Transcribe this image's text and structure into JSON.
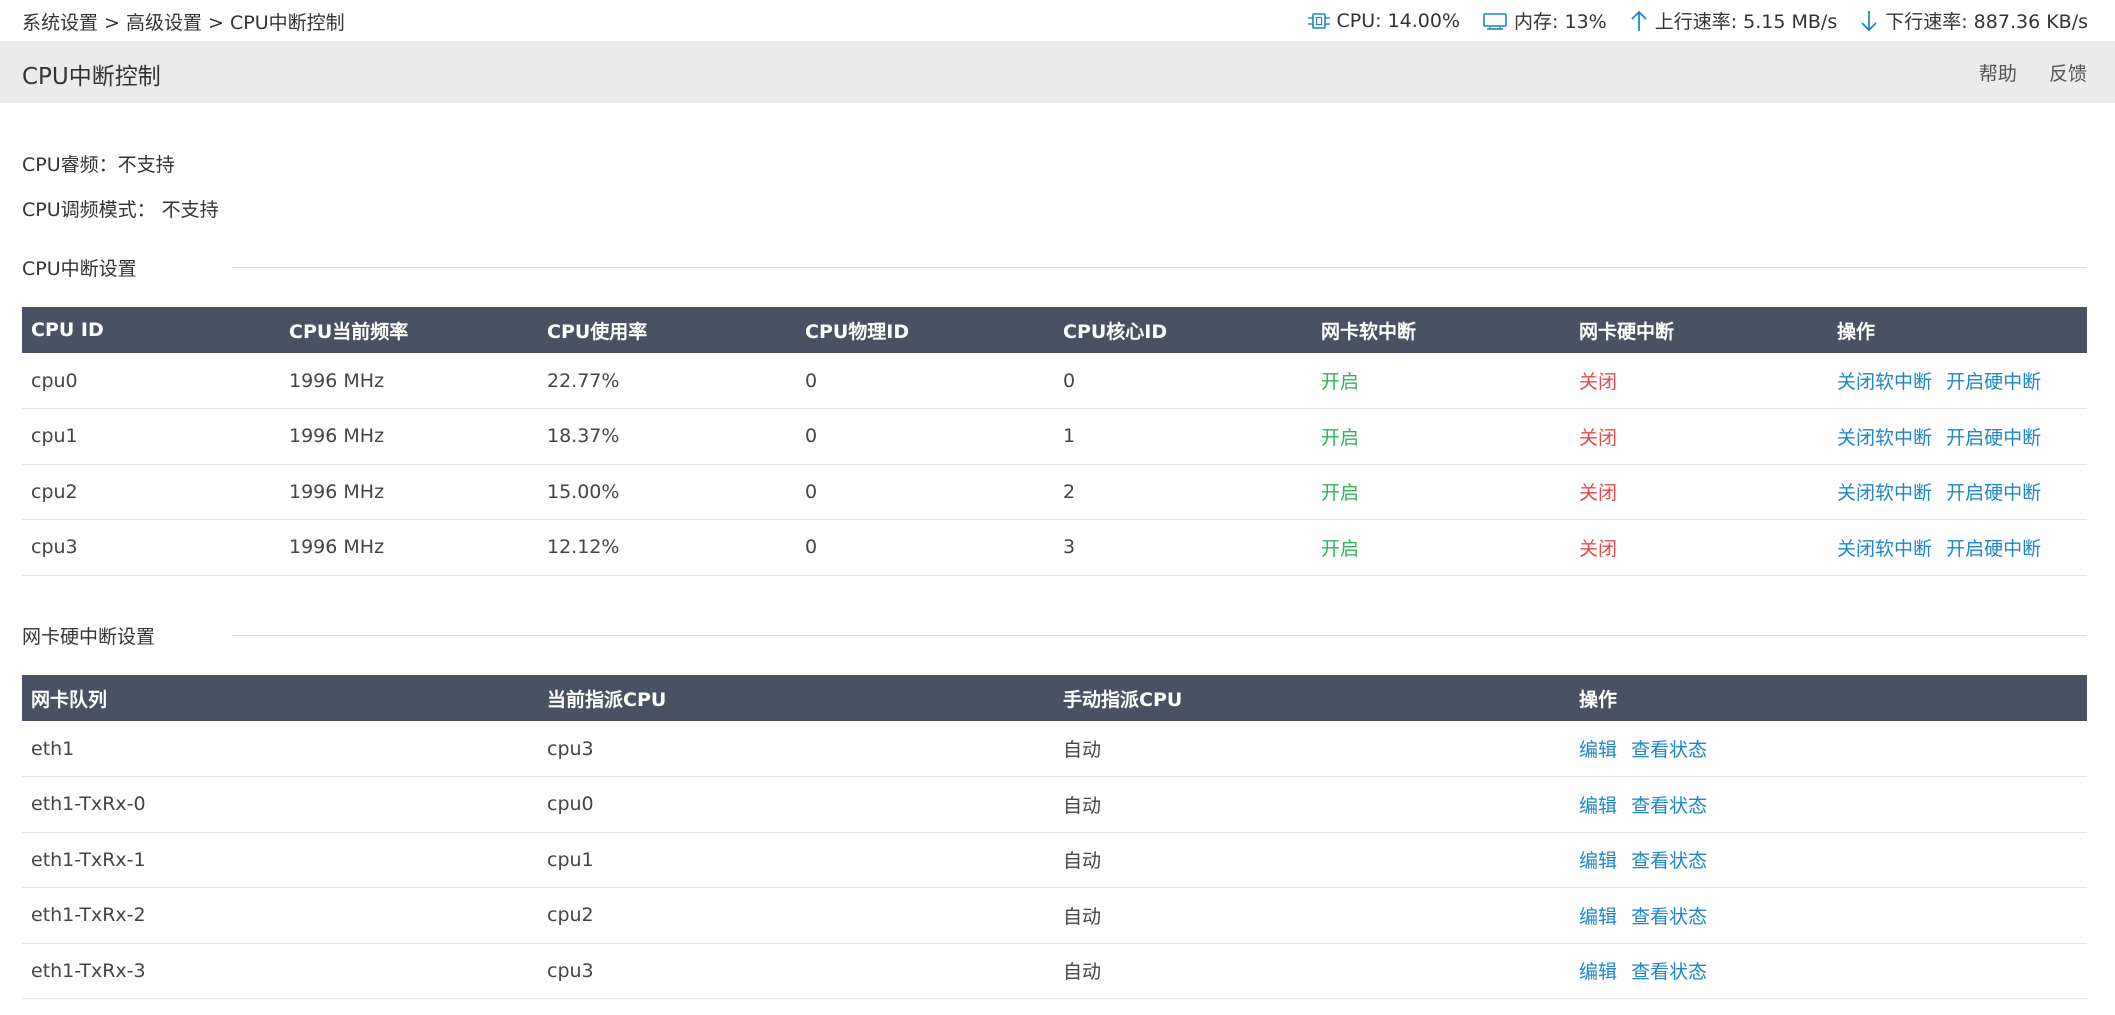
{
  "breadcrumb": "系统设置 > 高级设置 > CPU中断控制",
  "stats": {
    "cpu": "CPU: 14.00%",
    "memory": "内存: 13%",
    "upload": "上行速率: 5.15 MB/s",
    "download": "下行速率: 887.36 KB/s"
  },
  "icons": {
    "cpu": "cpu-chip-icon",
    "memory": "memory-icon",
    "upload": "arrow-up-icon",
    "download": "arrow-down-icon"
  },
  "title_bar": {
    "title": "CPU中断控制",
    "help": "帮助",
    "feedback": "反馈"
  },
  "info": {
    "turbo": "CPU睿频：不支持",
    "governor": "CPU调频模式： 不支持"
  },
  "cpu_section": {
    "title": "CPU中断设置",
    "columns": [
      "CPU ID",
      "CPU当前频率",
      "CPU使用率",
      "CPU物理ID",
      "CPU核心ID",
      "网卡软中断",
      "网卡硬中断",
      "操作"
    ],
    "rows": [
      {
        "id": "cpu0",
        "freq": "1996 MHz",
        "usage": "22.77%",
        "phys": "0",
        "core": "0",
        "soft": "开启",
        "hard": "关闭",
        "action1": "关闭软中断",
        "action2": "开启硬中断"
      },
      {
        "id": "cpu1",
        "freq": "1996 MHz",
        "usage": "18.37%",
        "phys": "0",
        "core": "1",
        "soft": "开启",
        "hard": "关闭",
        "action1": "关闭软中断",
        "action2": "开启硬中断"
      },
      {
        "id": "cpu2",
        "freq": "1996 MHz",
        "usage": "15.00%",
        "phys": "0",
        "core": "2",
        "soft": "开启",
        "hard": "关闭",
        "action1": "关闭软中断",
        "action2": "开启硬中断"
      },
      {
        "id": "cpu3",
        "freq": "1996 MHz",
        "usage": "12.12%",
        "phys": "0",
        "core": "3",
        "soft": "开启",
        "hard": "关闭",
        "action1": "关闭软中断",
        "action2": "开启硬中断"
      }
    ]
  },
  "nic_section": {
    "title": "网卡硬中断设置",
    "columns": [
      "网卡队列",
      "当前指派CPU",
      "手动指派CPU",
      "操作"
    ],
    "rows": [
      {
        "queue": "eth1",
        "current": "cpu3",
        "manual": "自动",
        "edit": "编辑",
        "view": "查看状态"
      },
      {
        "queue": "eth1-TxRx-0",
        "current": "cpu0",
        "manual": "自动",
        "edit": "编辑",
        "view": "查看状态"
      },
      {
        "queue": "eth1-TxRx-1",
        "current": "cpu1",
        "manual": "自动",
        "edit": "编辑",
        "view": "查看状态"
      },
      {
        "queue": "eth1-TxRx-2",
        "current": "cpu2",
        "manual": "自动",
        "edit": "编辑",
        "view": "查看状态"
      },
      {
        "queue": "eth1-TxRx-3",
        "current": "cpu3",
        "manual": "自动",
        "edit": "编辑",
        "view": "查看状态"
      }
    ]
  },
  "colors": {
    "header_bg": "#4a5164",
    "title_bar_bg": "#ebebeb",
    "status_on": "#2fb45b",
    "status_off": "#e8474c",
    "link": "#1e86c8"
  }
}
